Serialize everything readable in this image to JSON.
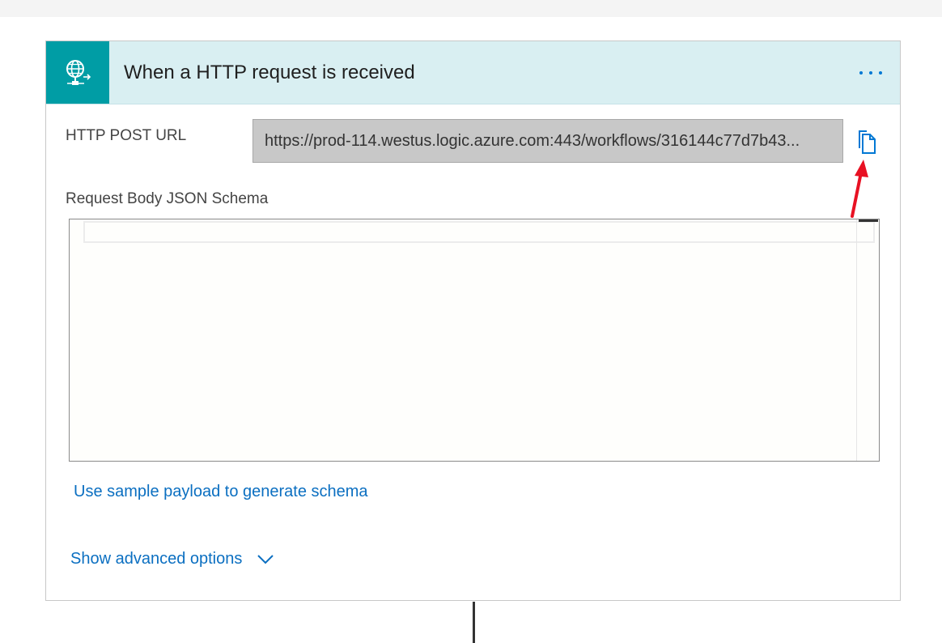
{
  "card": {
    "title": "When a HTTP request is received",
    "header_icon": "globe-request-icon",
    "more_icon": "more-options-icon",
    "accent_color": "#009da5",
    "header_color": "#d9eff2"
  },
  "fields": {
    "url_label": "HTTP POST URL",
    "url_value": "https://prod-114.westus.logic.azure.com:443/workflows/316144c77d7b43...",
    "copy_icon": "copy-icon",
    "schema_label": "Request Body JSON Schema",
    "schema_value": ""
  },
  "links": {
    "sample_payload": "Use sample payload to generate schema",
    "advanced_options": "Show advanced options",
    "advanced_icon": "chevron-down-icon",
    "link_color": "#0b6fc1"
  },
  "annotation": {
    "arrow_color": "#e81123"
  }
}
